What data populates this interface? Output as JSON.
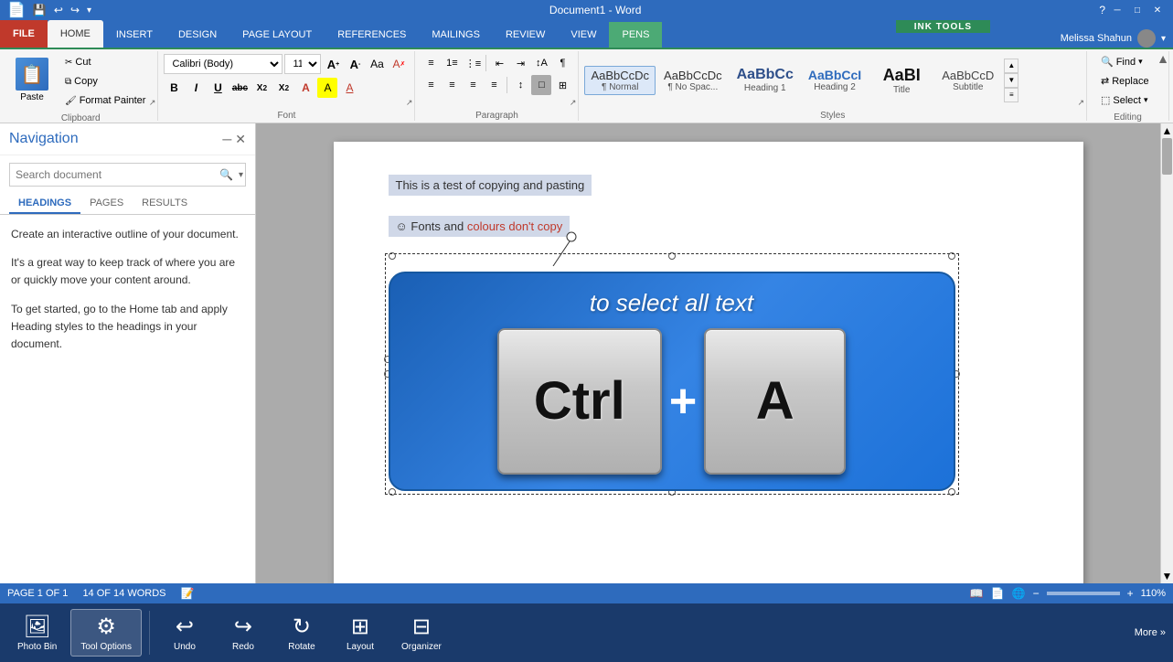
{
  "titlebar": {
    "title": "Document1 - Word",
    "minimize": "─",
    "restore": "□",
    "close": "✕"
  },
  "ink_tools_header": "INK TOOLS",
  "tabs": {
    "file": "FILE",
    "home": "HOME",
    "insert": "INSERT",
    "design": "DESIGN",
    "page_layout": "PAGE LAYOUT",
    "references": "REFERENCES",
    "mailings": "MAILINGS",
    "review": "REVIEW",
    "view": "VIEW",
    "pens": "PENS"
  },
  "clipboard": {
    "label": "Clipboard",
    "paste": "Paste",
    "cut": "Cut",
    "copy": "Copy",
    "format_painter": "Format Painter"
  },
  "font": {
    "label": "Font",
    "name": "Calibri (Body)",
    "size": "11",
    "bold": "B",
    "italic": "I",
    "underline": "U",
    "strikethrough": "ab",
    "subscript": "X₂",
    "superscript": "X²",
    "increase": "A",
    "decrease": "A",
    "clear": "A",
    "color_a": "A",
    "highlight": "A"
  },
  "paragraph": {
    "label": "Paragraph"
  },
  "styles": {
    "label": "Styles",
    "items": [
      {
        "id": "normal",
        "text": "¶ Normal",
        "class": "style-normal",
        "active": true
      },
      {
        "id": "nospace",
        "text": "¶ No Spac...",
        "class": "style-nospace"
      },
      {
        "id": "h1",
        "text": "Heading 1",
        "class": "style-h1"
      },
      {
        "id": "h2",
        "text": "Heading 2",
        "class": "style-h2"
      },
      {
        "id": "title",
        "text": "Title",
        "class": "style-title"
      },
      {
        "id": "subtitle",
        "text": "Subtitle",
        "class": "style-subtitle"
      }
    ]
  },
  "editing": {
    "label": "Editing",
    "find": "Find",
    "replace": "Replace",
    "select": "Select"
  },
  "navigation": {
    "title": "Navigation",
    "search_placeholder": "Search document",
    "tabs": [
      {
        "id": "headings",
        "label": "HEADINGS",
        "active": true
      },
      {
        "id": "pages",
        "label": "PAGES"
      },
      {
        "id": "results",
        "label": "RESULTS"
      }
    ],
    "content": [
      "Create an interactive outline of your document.",
      "It's a great way to keep track of where you are or quickly move your content around.",
      "To get started, go to the Home tab and apply Heading styles to the headings in your document."
    ]
  },
  "document": {
    "text1": "This is a test of copying and pasting",
    "text2_prefix": "Fonts and ",
    "text2_colored": "colours don't copy",
    "graphic": {
      "instruction": "to select all text",
      "key1": "Ctrl",
      "key2": "A",
      "plus": "+"
    }
  },
  "status_bar": {
    "page": "PAGE 1 OF 1",
    "words": "14 OF 14 WORDS",
    "zoom": "110%"
  },
  "taskbar": {
    "items": [
      {
        "id": "photo-bin",
        "label": "Photo Bin",
        "icon": "🖼"
      },
      {
        "id": "tool-options",
        "label": "Tool Options",
        "icon": "🔧"
      },
      {
        "id": "undo",
        "label": "Undo",
        "icon": "↩"
      },
      {
        "id": "redo",
        "label": "Redo",
        "icon": "↪"
      },
      {
        "id": "rotate",
        "label": "Rotate",
        "icon": "↻"
      },
      {
        "id": "layout",
        "label": "Layout",
        "icon": "⊞"
      },
      {
        "id": "organizer",
        "label": "Organizer",
        "icon": "⊟"
      }
    ],
    "more": "More »"
  },
  "user": {
    "name": "Melissa Shahun"
  }
}
